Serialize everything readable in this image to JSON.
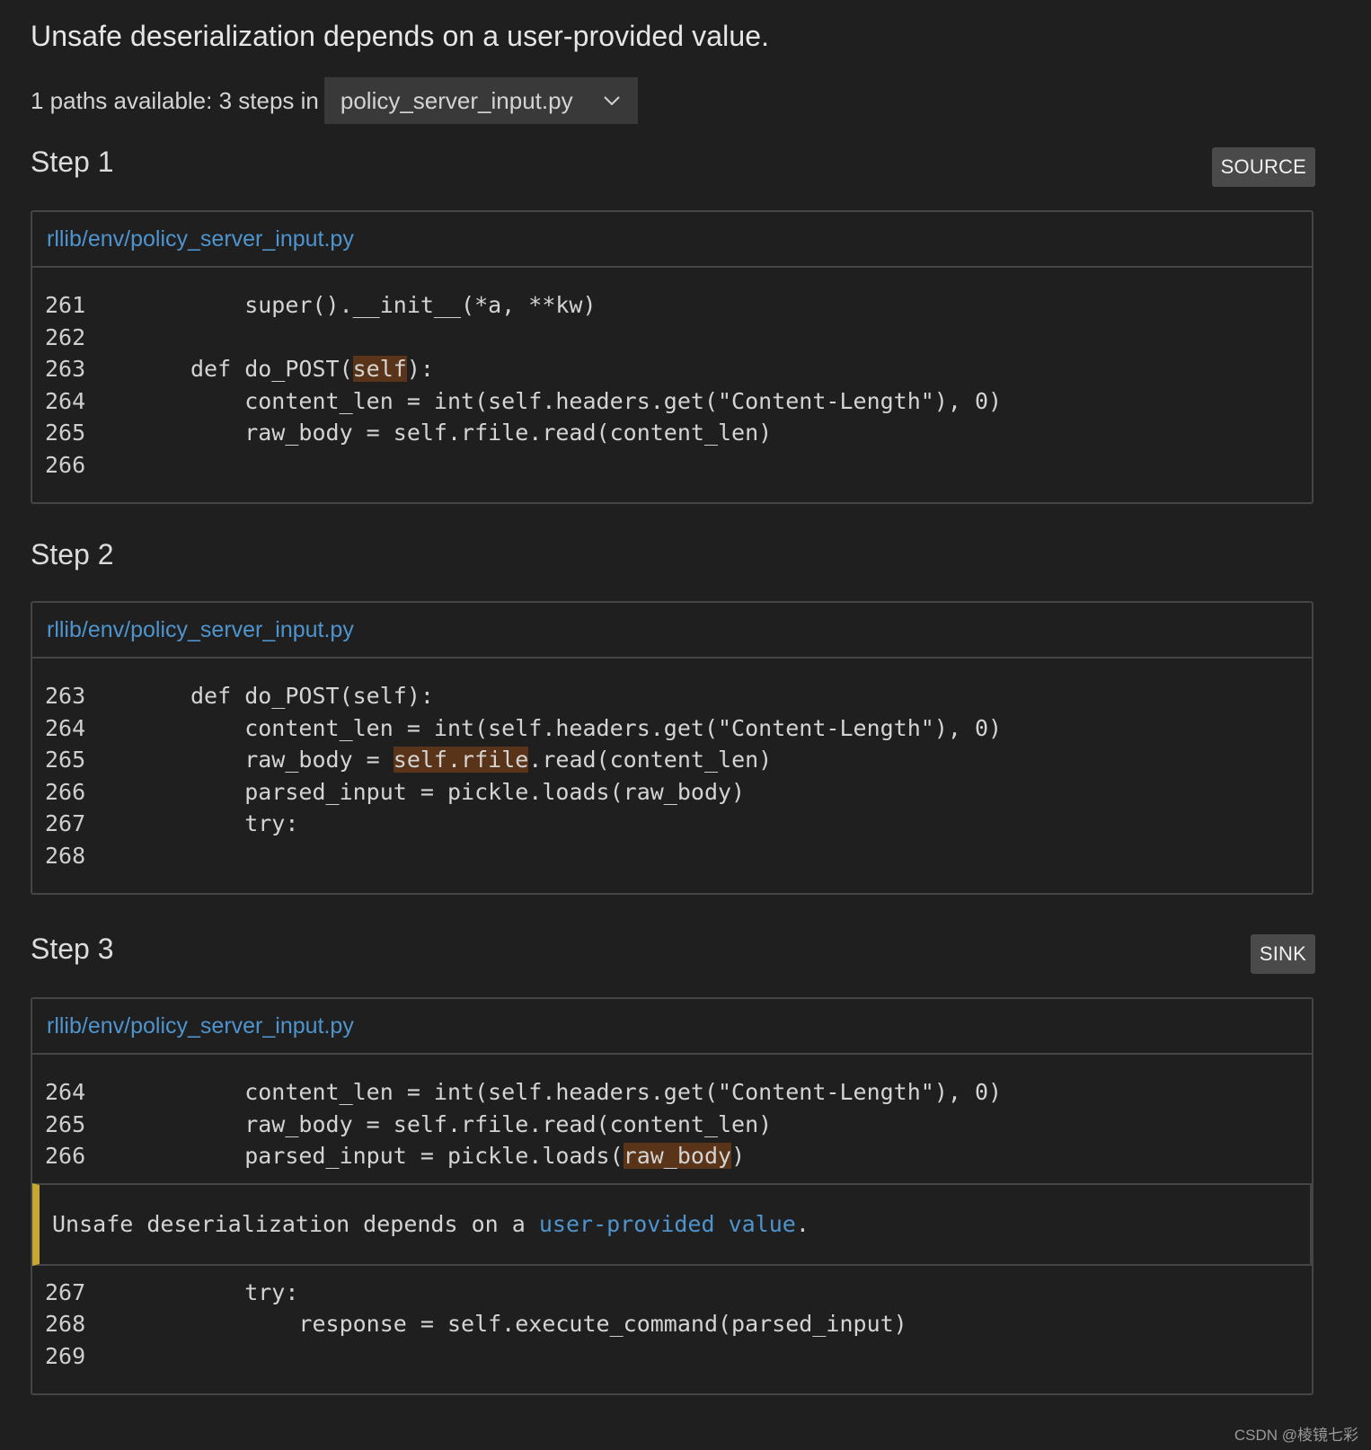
{
  "alert_title": "Unsafe deserialization depends on a user-provided value.",
  "paths": {
    "text": "1 paths available: 3 steps in",
    "selected_file": "policy_server_input.py"
  },
  "steps": [
    {
      "heading": "Step 1",
      "badge": "SOURCE",
      "file": "rllib/env/policy_server_input.py",
      "lines": [
        {
          "num": "261",
          "pre": "    super().__init__(*a, **kw)",
          "hl": "",
          "post": ""
        },
        {
          "num": "262",
          "pre": "",
          "hl": "",
          "post": ""
        },
        {
          "num": "263",
          "pre": "def do_POST(",
          "hl": "self",
          "post": "):"
        },
        {
          "num": "264",
          "pre": "    content_len = int(self.headers.get(\"Content-Length\"), 0)",
          "hl": "",
          "post": ""
        },
        {
          "num": "265",
          "pre": "    raw_body = self.rfile.read(content_len)",
          "hl": "",
          "post": ""
        },
        {
          "num": "266",
          "pre": "",
          "hl": "",
          "post": ""
        }
      ]
    },
    {
      "heading": "Step 2",
      "badge": "",
      "file": "rllib/env/policy_server_input.py",
      "lines": [
        {
          "num": "263",
          "pre": "def do_POST(self):",
          "hl": "",
          "post": ""
        },
        {
          "num": "264",
          "pre": "    content_len = int(self.headers.get(\"Content-Length\"), 0)",
          "hl": "",
          "post": ""
        },
        {
          "num": "265",
          "pre": "    raw_body = ",
          "hl": "self.rfile",
          "post": ".read(content_len)"
        },
        {
          "num": "266",
          "pre": "    parsed_input = pickle.loads(raw_body)",
          "hl": "",
          "post": ""
        },
        {
          "num": "267",
          "pre": "    try:",
          "hl": "",
          "post": ""
        },
        {
          "num": "268",
          "pre": "",
          "hl": "",
          "post": ""
        }
      ]
    },
    {
      "heading": "Step 3",
      "badge": "SINK",
      "file": "rllib/env/policy_server_input.py",
      "lines_before": [
        {
          "num": "264",
          "pre": "    content_len = int(self.headers.get(\"Content-Length\"), 0)",
          "hl": "",
          "post": ""
        },
        {
          "num": "265",
          "pre": "    raw_body = self.rfile.read(content_len)",
          "hl": "",
          "post": ""
        },
        {
          "num": "266",
          "pre": "    parsed_input = pickle.loads(",
          "hl": "raw_body",
          "post": ")"
        }
      ],
      "alert": {
        "pre": "Unsafe deserialization depends on a ",
        "link": "user-provided value",
        "post": "."
      },
      "lines_after": [
        {
          "num": "267",
          "pre": "    try:",
          "hl": "",
          "post": ""
        },
        {
          "num": "268",
          "pre": "        response = self.execute_command(parsed_input)",
          "hl": "",
          "post": ""
        },
        {
          "num": "269",
          "pre": "",
          "hl": "",
          "post": ""
        }
      ]
    }
  ],
  "watermark": "CSDN @棱镜七彩",
  "icons": {
    "dropdown": "chevron-down-icon"
  },
  "colors": {
    "background": "#1f1f1f",
    "link": "#4e94ce",
    "highlight": "#5a3418",
    "alert_bar": "#c8a632",
    "badge_bg": "#4a4a4a"
  }
}
